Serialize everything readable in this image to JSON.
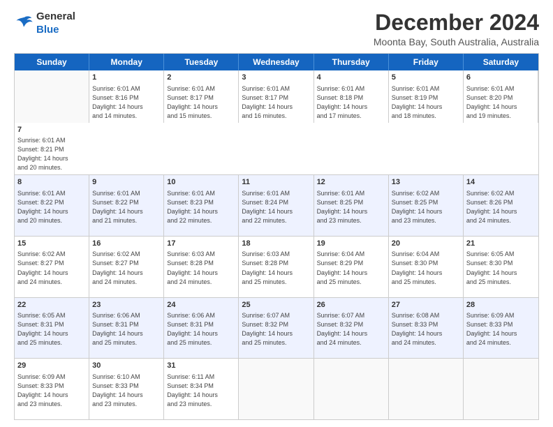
{
  "header": {
    "logo_general": "General",
    "logo_blue": "Blue",
    "main_title": "December 2024",
    "subtitle": "Moonta Bay, South Australia, Australia"
  },
  "calendar": {
    "days_of_week": [
      "Sunday",
      "Monday",
      "Tuesday",
      "Wednesday",
      "Thursday",
      "Friday",
      "Saturday"
    ],
    "weeks": [
      [
        {
          "num": "",
          "info": "",
          "empty": true
        },
        {
          "num": "2",
          "info": "Sunrise: 6:01 AM\nSunset: 8:17 PM\nDaylight: 14 hours\nand 15 minutes."
        },
        {
          "num": "3",
          "info": "Sunrise: 6:01 AM\nSunset: 8:17 PM\nDaylight: 14 hours\nand 16 minutes."
        },
        {
          "num": "4",
          "info": "Sunrise: 6:01 AM\nSunset: 8:18 PM\nDaylight: 14 hours\nand 17 minutes."
        },
        {
          "num": "5",
          "info": "Sunrise: 6:01 AM\nSunset: 8:19 PM\nDaylight: 14 hours\nand 18 minutes."
        },
        {
          "num": "6",
          "info": "Sunrise: 6:01 AM\nSunset: 8:20 PM\nDaylight: 14 hours\nand 19 minutes."
        },
        {
          "num": "7",
          "info": "Sunrise: 6:01 AM\nSunset: 8:21 PM\nDaylight: 14 hours\nand 20 minutes."
        }
      ],
      [
        {
          "num": "8",
          "info": "Sunrise: 6:01 AM\nSunset: 8:22 PM\nDaylight: 14 hours\nand 20 minutes."
        },
        {
          "num": "9",
          "info": "Sunrise: 6:01 AM\nSunset: 8:22 PM\nDaylight: 14 hours\nand 21 minutes."
        },
        {
          "num": "10",
          "info": "Sunrise: 6:01 AM\nSunset: 8:23 PM\nDaylight: 14 hours\nand 22 minutes."
        },
        {
          "num": "11",
          "info": "Sunrise: 6:01 AM\nSunset: 8:24 PM\nDaylight: 14 hours\nand 22 minutes."
        },
        {
          "num": "12",
          "info": "Sunrise: 6:01 AM\nSunset: 8:25 PM\nDaylight: 14 hours\nand 23 minutes."
        },
        {
          "num": "13",
          "info": "Sunrise: 6:02 AM\nSunset: 8:25 PM\nDaylight: 14 hours\nand 23 minutes."
        },
        {
          "num": "14",
          "info": "Sunrise: 6:02 AM\nSunset: 8:26 PM\nDaylight: 14 hours\nand 24 minutes."
        }
      ],
      [
        {
          "num": "15",
          "info": "Sunrise: 6:02 AM\nSunset: 8:27 PM\nDaylight: 14 hours\nand 24 minutes."
        },
        {
          "num": "16",
          "info": "Sunrise: 6:02 AM\nSunset: 8:27 PM\nDaylight: 14 hours\nand 24 minutes."
        },
        {
          "num": "17",
          "info": "Sunrise: 6:03 AM\nSunset: 8:28 PM\nDaylight: 14 hours\nand 24 minutes."
        },
        {
          "num": "18",
          "info": "Sunrise: 6:03 AM\nSunset: 8:28 PM\nDaylight: 14 hours\nand 25 minutes."
        },
        {
          "num": "19",
          "info": "Sunrise: 6:04 AM\nSunset: 8:29 PM\nDaylight: 14 hours\nand 25 minutes."
        },
        {
          "num": "20",
          "info": "Sunrise: 6:04 AM\nSunset: 8:30 PM\nDaylight: 14 hours\nand 25 minutes."
        },
        {
          "num": "21",
          "info": "Sunrise: 6:05 AM\nSunset: 8:30 PM\nDaylight: 14 hours\nand 25 minutes."
        }
      ],
      [
        {
          "num": "22",
          "info": "Sunrise: 6:05 AM\nSunset: 8:31 PM\nDaylight: 14 hours\nand 25 minutes."
        },
        {
          "num": "23",
          "info": "Sunrise: 6:06 AM\nSunset: 8:31 PM\nDaylight: 14 hours\nand 25 minutes."
        },
        {
          "num": "24",
          "info": "Sunrise: 6:06 AM\nSunset: 8:31 PM\nDaylight: 14 hours\nand 25 minutes."
        },
        {
          "num": "25",
          "info": "Sunrise: 6:07 AM\nSunset: 8:32 PM\nDaylight: 14 hours\nand 25 minutes."
        },
        {
          "num": "26",
          "info": "Sunrise: 6:07 AM\nSunset: 8:32 PM\nDaylight: 14 hours\nand 24 minutes."
        },
        {
          "num": "27",
          "info": "Sunrise: 6:08 AM\nSunset: 8:33 PM\nDaylight: 14 hours\nand 24 minutes."
        },
        {
          "num": "28",
          "info": "Sunrise: 6:09 AM\nSunset: 8:33 PM\nDaylight: 14 hours\nand 24 minutes."
        }
      ],
      [
        {
          "num": "29",
          "info": "Sunrise: 6:09 AM\nSunset: 8:33 PM\nDaylight: 14 hours\nand 23 minutes."
        },
        {
          "num": "30",
          "info": "Sunrise: 6:10 AM\nSunset: 8:33 PM\nDaylight: 14 hours\nand 23 minutes."
        },
        {
          "num": "31",
          "info": "Sunrise: 6:11 AM\nSunset: 8:34 PM\nDaylight: 14 hours\nand 23 minutes."
        },
        {
          "num": "",
          "info": "",
          "empty": true
        },
        {
          "num": "",
          "info": "",
          "empty": true
        },
        {
          "num": "",
          "info": "",
          "empty": true
        },
        {
          "num": "",
          "info": "",
          "empty": true
        }
      ]
    ],
    "week1_day1": {
      "num": "1",
      "info": "Sunrise: 6:01 AM\nSunset: 8:16 PM\nDaylight: 14 hours\nand 14 minutes."
    }
  }
}
